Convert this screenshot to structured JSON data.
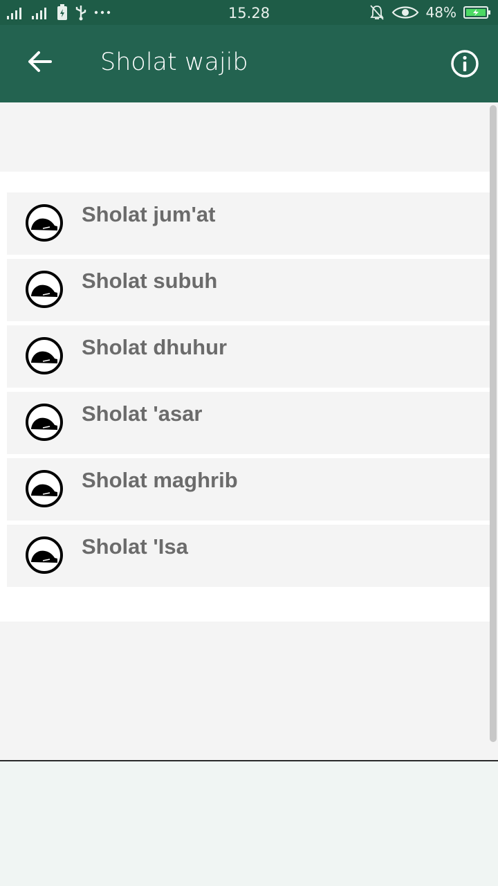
{
  "status_bar": {
    "time": "15.28",
    "battery": "48%"
  },
  "app_bar": {
    "title": "Sholat wajib",
    "back_icon": "arrow-left-icon",
    "info_icon": "info-icon"
  },
  "list": {
    "items": [
      {
        "label": "Sholat jum'at",
        "icon": "prayer-icon"
      },
      {
        "label": "Sholat subuh",
        "icon": "prayer-icon"
      },
      {
        "label": "Sholat dhuhur",
        "icon": "prayer-icon"
      },
      {
        "label": "Sholat 'asar",
        "icon": "prayer-icon"
      },
      {
        "label": "Sholat maghrib",
        "icon": "prayer-icon"
      },
      {
        "label": "Sholat 'Isa",
        "icon": "prayer-icon"
      }
    ]
  },
  "colors": {
    "app_bar": "#236350",
    "status_bar": "#1e5c47",
    "item_bg": "#f4f4f4",
    "label_text": "#6b6b6b"
  }
}
